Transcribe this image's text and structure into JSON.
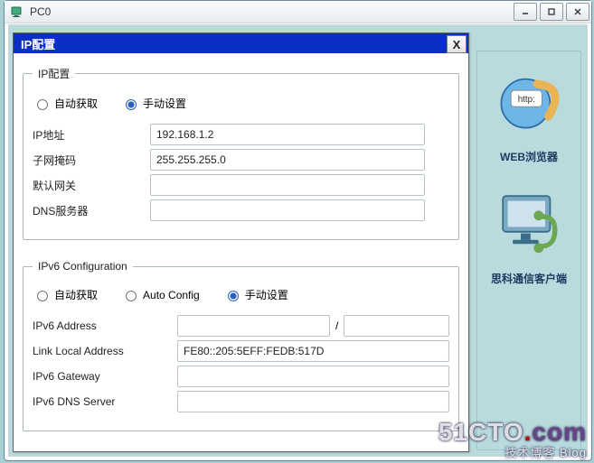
{
  "outer": {
    "title": "PC0"
  },
  "dialog": {
    "title": "IP配置",
    "close_label": "X"
  },
  "ip4": {
    "legend": "IP配置",
    "auto_label": "自动获取",
    "manual_label": "手动设置",
    "selected": "manual",
    "ip_label": "IP地址",
    "ip_value": "192.168.1.2",
    "mask_label": "子网掩码",
    "mask_value": "255.255.255.0",
    "gateway_label": "默认网关",
    "gateway_value": "",
    "dns_label": "DNS服务器",
    "dns_value": ""
  },
  "ip6": {
    "legend": "IPv6 Configuration",
    "auto_label": "自动获取",
    "autoconf_label": "Auto Config",
    "manual_label": "手动设置",
    "selected": "manual",
    "addr_label": "IPv6 Address",
    "addr_value": "",
    "prefix_value": "",
    "linklocal_label": "Link Local Address",
    "linklocal_value": "FE80::205:5EFF:FEDB:517D",
    "gateway_label": "IPv6 Gateway",
    "gateway_value": "",
    "dns_label": "IPv6 DNS Server",
    "dns_value": ""
  },
  "side": {
    "browser_label": "WEB浏览器",
    "client_label": "思科通信客户端"
  },
  "watermark": {
    "site": "51CTO.com",
    "tagline": "技术博客     Blog"
  }
}
